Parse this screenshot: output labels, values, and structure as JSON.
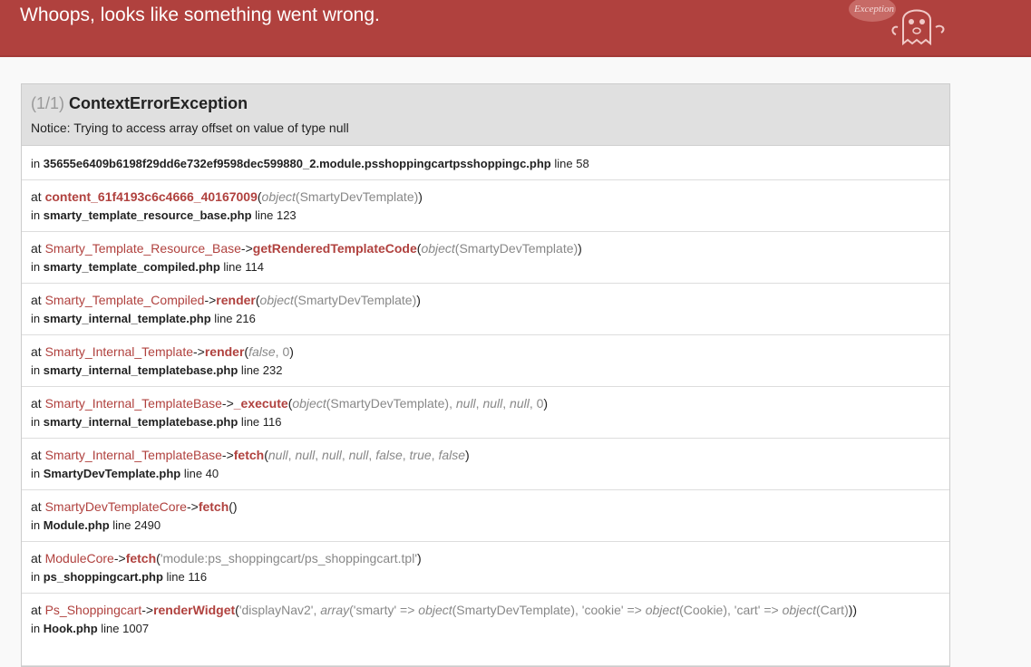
{
  "header": {
    "title": "Whoops, looks like something went wrong.",
    "logo_text": "Exception",
    "colors": {
      "background": "#b0413e",
      "accent": "#b0413e"
    }
  },
  "exception": {
    "count": "(1/1)",
    "class": "ContextErrorException",
    "message": "Notice: Trying to access array offset on value of type null"
  },
  "first_location": {
    "prefix": "in",
    "file": "35655e6409b6198f29dd6e732ef9598dec599880_2.module.psshoppingcartpsshoppingc.php",
    "line": "line 58"
  },
  "frames": [
    {
      "prefix": "at",
      "class": "",
      "arrow": "",
      "function": "content_61f4193c6c4666_40167009",
      "args_html": "(<span class=\"argi\">object</span><span class=\"arg\">(SmartyDevTemplate)</span>)",
      "file": "smarty_template_resource_base.php",
      "line": "line 123"
    },
    {
      "prefix": "at",
      "class": "Smarty_Template_Resource_Base",
      "arrow": "->",
      "function": "getRenderedTemplateCode",
      "args_html": "(<span class=\"argi\">object</span><span class=\"arg\">(SmartyDevTemplate)</span>)",
      "file": "smarty_template_compiled.php",
      "line": "line 114"
    },
    {
      "prefix": "at",
      "class": "Smarty_Template_Compiled",
      "arrow": "->",
      "function": "render",
      "args_html": "(<span class=\"argi\">object</span><span class=\"arg\">(SmartyDevTemplate)</span>)",
      "file": "smarty_internal_template.php",
      "line": "line 216"
    },
    {
      "prefix": "at",
      "class": "Smarty_Internal_Template",
      "arrow": "->",
      "function": "render",
      "args_html": "(<span class=\"argi\">false</span><span class=\"arg\">, 0</span>)",
      "file": "smarty_internal_templatebase.php",
      "line": "line 232"
    },
    {
      "prefix": "at",
      "class": "Smarty_Internal_TemplateBase",
      "arrow": "->",
      "function": "_execute",
      "args_html": "(<span class=\"argi\">object</span><span class=\"arg\">(SmartyDevTemplate), </span><span class=\"argi\">null</span><span class=\"arg\">, </span><span class=\"argi\">null</span><span class=\"arg\">, </span><span class=\"argi\">null</span><span class=\"arg\">, 0</span>)",
      "file": "smarty_internal_templatebase.php",
      "line": "line 116"
    },
    {
      "prefix": "at",
      "class": "Smarty_Internal_TemplateBase",
      "arrow": "->",
      "function": "fetch",
      "args_html": "(<span class=\"argi\">null</span><span class=\"arg\">, </span><span class=\"argi\">null</span><span class=\"arg\">, </span><span class=\"argi\">null</span><span class=\"arg\">, </span><span class=\"argi\">null</span><span class=\"arg\">, </span><span class=\"argi\">false</span><span class=\"arg\">, </span><span class=\"argi\">true</span><span class=\"arg\">, </span><span class=\"argi\">false</span>)",
      "file": "SmartyDevTemplate.php",
      "line": "line 40"
    },
    {
      "prefix": "at",
      "class": "SmartyDevTemplateCore",
      "arrow": "->",
      "function": "fetch",
      "args_html": "()",
      "file": "Module.php",
      "line": "line 2490"
    },
    {
      "prefix": "at",
      "class": "ModuleCore",
      "arrow": "->",
      "function": "fetch",
      "args_html": "(<span class=\"arg\">'module:ps_shoppingcart/ps_shoppingcart.tpl'</span>)",
      "file": "ps_shoppingcart.php",
      "line": "line 116"
    },
    {
      "prefix": "at",
      "class": "Ps_Shoppingcart",
      "arrow": "->",
      "function": "renderWidget",
      "args_html": "(<span class=\"arg\">'displayNav2', </span><span class=\"argi\">array</span><span class=\"arg\">('smarty' =&gt; </span><span class=\"argi\">object</span><span class=\"arg\">(SmartyDevTemplate), 'cookie' =&gt; </span><span class=\"argi\">object</span><span class=\"arg\">(Cookie), 'cart' =&gt; </span><span class=\"argi\">object</span><span class=\"arg\">(Cart)</span>))",
      "file": "Hook.php",
      "line": "line 1007"
    }
  ]
}
